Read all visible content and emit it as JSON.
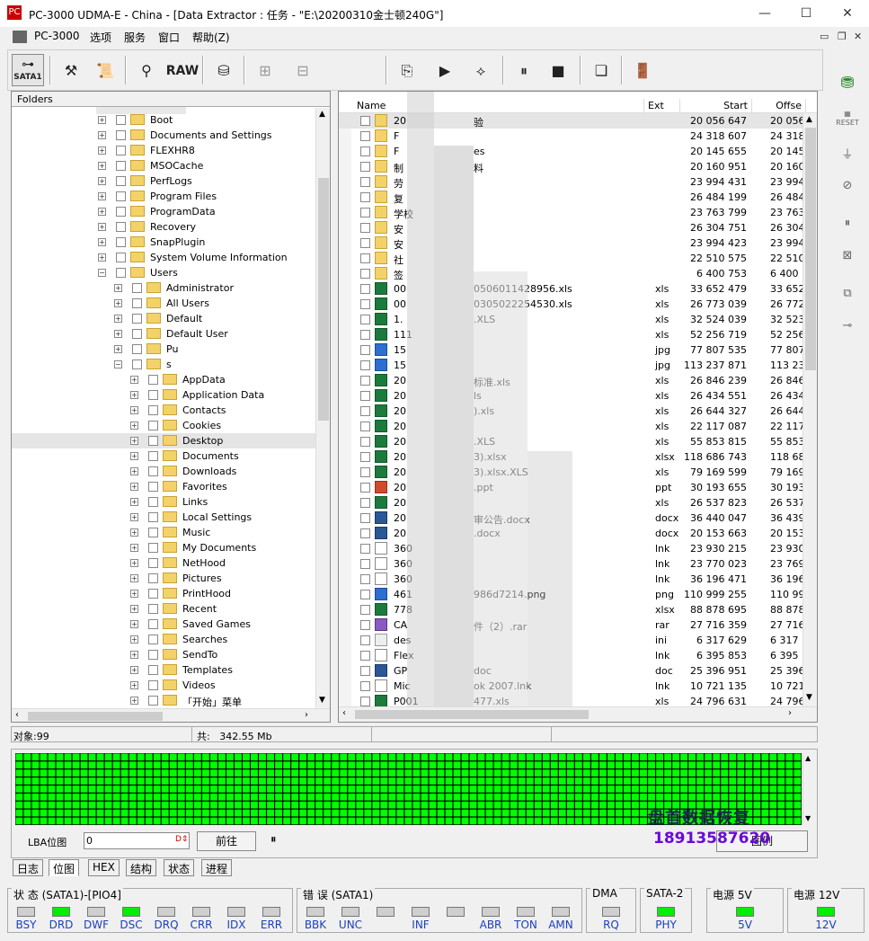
{
  "window": {
    "title": "PC-3000 UDMA-E - China - [Data Extractor : 任务 - \"E:\\20200310金士顿240G\"]",
    "minimize_glyph": "—",
    "maximize_glyph": "☐",
    "close_glyph": "✕"
  },
  "menu": {
    "items": [
      "PC-3000",
      "选项",
      "服务",
      "窗口",
      "帮助(Z)"
    ]
  },
  "toolbar": {
    "sata_label": "SATA1",
    "raw_label": "RAW"
  },
  "rightbar": {
    "reset_label": "RESET"
  },
  "folders": {
    "header": "Folders",
    "items": [
      {
        "label": "Boot",
        "level": 0,
        "expander": "+"
      },
      {
        "label": "Documents and Settings",
        "level": 0,
        "expander": "+"
      },
      {
        "label": "FLEXHR8",
        "level": 0,
        "expander": "+"
      },
      {
        "label": "MSOCache",
        "level": 0,
        "expander": "+"
      },
      {
        "label": "PerfLogs",
        "level": 0,
        "expander": "+"
      },
      {
        "label": "Program Files",
        "level": 0,
        "expander": "+"
      },
      {
        "label": "ProgramData",
        "level": 0,
        "expander": "+"
      },
      {
        "label": "Recovery",
        "level": 0,
        "expander": "+"
      },
      {
        "label": "SnapPlugin",
        "level": 0,
        "expander": "+"
      },
      {
        "label": "System Volume Information",
        "level": 0,
        "expander": "+"
      },
      {
        "label": "Users",
        "level": 0,
        "expander": "−"
      },
      {
        "label": "Administrator",
        "level": 1,
        "expander": "+"
      },
      {
        "label": "All Users",
        "level": 1,
        "expander": "+"
      },
      {
        "label": "Default",
        "level": 1,
        "expander": "+"
      },
      {
        "label": "Default User",
        "level": 1,
        "expander": "+"
      },
      {
        "label": "Pu",
        "level": 1,
        "expander": "+"
      },
      {
        "label": "s",
        "level": 1,
        "expander": "−"
      },
      {
        "label": "AppData",
        "level": 2,
        "expander": "+"
      },
      {
        "label": "Application Data",
        "level": 2,
        "expander": "+"
      },
      {
        "label": "Contacts",
        "level": 2,
        "expander": "+"
      },
      {
        "label": "Cookies",
        "level": 2,
        "expander": "+"
      },
      {
        "label": "Desktop",
        "level": 2,
        "expander": "+"
      },
      {
        "label": "Documents",
        "level": 2,
        "expander": "+"
      },
      {
        "label": "Downloads",
        "level": 2,
        "expander": "+"
      },
      {
        "label": "Favorites",
        "level": 2,
        "expander": "+"
      },
      {
        "label": "Links",
        "level": 2,
        "expander": "+"
      },
      {
        "label": "Local Settings",
        "level": 2,
        "expander": "+"
      },
      {
        "label": "Music",
        "level": 2,
        "expander": "+"
      },
      {
        "label": "My Documents",
        "level": 2,
        "expander": "+"
      },
      {
        "label": "NetHood",
        "level": 2,
        "expander": "+"
      },
      {
        "label": "Pictures",
        "level": 2,
        "expander": "+"
      },
      {
        "label": "PrintHood",
        "level": 2,
        "expander": "+"
      },
      {
        "label": "Recent",
        "level": 2,
        "expander": "+"
      },
      {
        "label": "Saved Games",
        "level": 2,
        "expander": "+"
      },
      {
        "label": "Searches",
        "level": 2,
        "expander": "+"
      },
      {
        "label": "SendTo",
        "level": 2,
        "expander": "+"
      },
      {
        "label": "Templates",
        "level": 2,
        "expander": "+"
      },
      {
        "label": "Videos",
        "level": 2,
        "expander": "+"
      },
      {
        "label": "「开始」菜单",
        "level": 2,
        "expander": "+"
      }
    ]
  },
  "files": {
    "columns": {
      "name": "Name",
      "ext": "Ext",
      "start": "Start",
      "offset": "Offse"
    },
    "rows": [
      {
        "name": "20",
        "suffix": "验",
        "ext": "",
        "start": "20 056 647",
        "offset": "20 056",
        "icon": "folder"
      },
      {
        "name": "F",
        "suffix": "",
        "ext": "",
        "start": "24 318 607",
        "offset": "24 318",
        "icon": "folder"
      },
      {
        "name": "F",
        "suffix": "es",
        "ext": "",
        "start": "20 145 655",
        "offset": "20 145",
        "icon": "folder"
      },
      {
        "name": "制",
        "suffix": "料",
        "ext": "",
        "start": "20 160 951",
        "offset": "20 160",
        "icon": "folder"
      },
      {
        "name": "劳",
        "suffix": "",
        "ext": "",
        "start": "23 994 431",
        "offset": "23 994",
        "icon": "folder"
      },
      {
        "name": "复",
        "suffix": "",
        "ext": "",
        "start": "26 484 199",
        "offset": "26 484",
        "icon": "folder"
      },
      {
        "name": "学校",
        "suffix": "",
        "ext": "",
        "start": "23 763 799",
        "offset": "23 763",
        "icon": "folder"
      },
      {
        "name": "安",
        "suffix": "",
        "ext": "",
        "start": "26 304 751",
        "offset": "26 304",
        "icon": "folder"
      },
      {
        "name": "安",
        "suffix": "",
        "ext": "",
        "start": "23 994 423",
        "offset": "23 994",
        "icon": "folder"
      },
      {
        "name": "社",
        "suffix": "",
        "ext": "",
        "start": "22 510 575",
        "offset": "22 510",
        "icon": "folder"
      },
      {
        "name": "签",
        "suffix": "",
        "ext": "",
        "start": "6 400 753",
        "offset": "6 400",
        "icon": "folder"
      },
      {
        "name": "00",
        "suffix": "0506011428956.xls",
        "ext": "xls",
        "start": "33 652 479",
        "offset": "33 652",
        "icon": "xls"
      },
      {
        "name": "00",
        "suffix": "0305022254530.xls",
        "ext": "xls",
        "start": "26 773 039",
        "offset": "26 772",
        "icon": "xls"
      },
      {
        "name": "1.",
        "suffix": ".XLS",
        "ext": "xls",
        "start": "32 524 039",
        "offset": "32 523",
        "icon": "xls"
      },
      {
        "name": "111",
        "suffix": "",
        "ext": "xls",
        "start": "52 256 719",
        "offset": "52 256",
        "icon": "xls"
      },
      {
        "name": "15",
        "suffix": "",
        "ext": "jpg",
        "start": "77 807 535",
        "offset": "77 807",
        "icon": "img"
      },
      {
        "name": "15",
        "suffix": "",
        "ext": "jpg",
        "start": "113 237 871",
        "offset": "113 237",
        "icon": "img"
      },
      {
        "name": "20",
        "suffix": "标准.xls",
        "ext": "xls",
        "start": "26 846 239",
        "offset": "26 846",
        "icon": "xls"
      },
      {
        "name": "20",
        "suffix": "ls",
        "ext": "xls",
        "start": "26 434 551",
        "offset": "26 434",
        "icon": "xls"
      },
      {
        "name": "20",
        "suffix": ").xls",
        "ext": "xls",
        "start": "26 644 327",
        "offset": "26 644",
        "icon": "xls"
      },
      {
        "name": "20",
        "suffix": "",
        "ext": "xls",
        "start": "22 117 087",
        "offset": "22 117",
        "icon": "xls"
      },
      {
        "name": "20",
        "suffix": ".XLS",
        "ext": "xls",
        "start": "55 853 815",
        "offset": "55 853",
        "icon": "xls"
      },
      {
        "name": "20",
        "suffix": "3).xlsx",
        "ext": "xlsx",
        "start": "118 686 743",
        "offset": "118 686",
        "icon": "xls"
      },
      {
        "name": "20",
        "suffix": "3).xlsx.XLS",
        "ext": "xls",
        "start": "79 169 599",
        "offset": "79 169",
        "icon": "xls"
      },
      {
        "name": "20",
        "suffix": ".ppt",
        "ext": "ppt",
        "start": "30 193 655",
        "offset": "30 193",
        "icon": "ppt"
      },
      {
        "name": "20",
        "suffix": "",
        "ext": "xls",
        "start": "26 537 823",
        "offset": "26 537",
        "icon": "xls"
      },
      {
        "name": "20",
        "suffix": "审公告.docx",
        "ext": "docx",
        "start": "36 440 047",
        "offset": "36 439",
        "icon": "doc"
      },
      {
        "name": "20",
        "suffix": ".docx",
        "ext": "docx",
        "start": "20 153 663",
        "offset": "20 153",
        "icon": "doc"
      },
      {
        "name": "360",
        "suffix": "",
        "ext": "lnk",
        "start": "23 930 215",
        "offset": "23 930",
        "icon": "lnk"
      },
      {
        "name": "360",
        "suffix": "",
        "ext": "lnk",
        "start": "23 770 023",
        "offset": "23 769",
        "icon": "lnk"
      },
      {
        "name": "360",
        "suffix": "",
        "ext": "lnk",
        "start": "36 196 471",
        "offset": "36 196",
        "icon": "lnk"
      },
      {
        "name": "461",
        "suffix": "986d7214.png",
        "ext": "png",
        "start": "110 999 255",
        "offset": "110 999",
        "icon": "img"
      },
      {
        "name": "778",
        "suffix": "",
        "ext": "xlsx",
        "start": "88 878 695",
        "offset": "88 878",
        "icon": "xls"
      },
      {
        "name": "CA",
        "suffix": "件（2）.rar",
        "ext": "rar",
        "start": "27 716 359",
        "offset": "27 716",
        "icon": "rar"
      },
      {
        "name": "des",
        "suffix": "",
        "ext": "ini",
        "start": "6 317 629",
        "offset": "6 317",
        "icon": "ini"
      },
      {
        "name": "Flex",
        "suffix": "",
        "ext": "lnk",
        "start": "6 395 853",
        "offset": "6 395",
        "icon": "lnk"
      },
      {
        "name": "GP",
        "suffix": "doc",
        "ext": "doc",
        "start": "25 396 951",
        "offset": "25 396",
        "icon": "doc"
      },
      {
        "name": "Mic",
        "suffix": "ok 2007.lnk",
        "ext": "lnk",
        "start": "10 721 135",
        "offset": "10 721",
        "icon": "lnk"
      },
      {
        "name": "P001",
        "suffix": "477.xls",
        "ext": "xls",
        "start": "24 796 631",
        "offset": "24 796",
        "icon": "xls"
      }
    ]
  },
  "status_strip": {
    "objects": "对象:99",
    "total": "共:   342.55 Mb"
  },
  "lba": {
    "label": "LBA位图",
    "value": "0",
    "go_button": "前往",
    "pause_glyph": "⏸",
    "legend_button": "图例",
    "grid_color": "#00ff00"
  },
  "bottom_tabs": [
    "日志",
    "位图",
    "HEX",
    "结构",
    "状态",
    "进程"
  ],
  "status_groups": {
    "state": {
      "title": "状 态 (SATA1)-[PIO4]",
      "leds": [
        {
          "label": "BSY",
          "on": false
        },
        {
          "label": "DRD",
          "on": true
        },
        {
          "label": "DWF",
          "on": false
        },
        {
          "label": "DSC",
          "on": true
        },
        {
          "label": "DRQ",
          "on": false
        },
        {
          "label": "CRR",
          "on": false
        },
        {
          "label": "IDX",
          "on": false
        },
        {
          "label": "ERR",
          "on": false
        }
      ]
    },
    "error": {
      "title": "错 误 (SATA1)",
      "leds": [
        {
          "label": "BBK",
          "on": false
        },
        {
          "label": "UNC",
          "on": false
        },
        {
          "label": "",
          "on": false
        },
        {
          "label": "INF",
          "on": false
        },
        {
          "label": "",
          "on": false
        },
        {
          "label": "ABR",
          "on": false
        },
        {
          "label": "TON",
          "on": false
        },
        {
          "label": "AMN",
          "on": false
        }
      ]
    },
    "dma": {
      "title": "DMA",
      "leds": [
        {
          "label": "RQ",
          "on": false
        }
      ]
    },
    "sata2": {
      "title": "SATA-2",
      "leds": [
        {
          "label": "PHY",
          "on": true
        }
      ]
    },
    "power5": {
      "title": "电源 5V",
      "leds": [
        {
          "label": "5V",
          "on": true
        }
      ]
    },
    "power12": {
      "title": "电源 12V",
      "leds": [
        {
          "label": "12V",
          "on": true
        }
      ]
    }
  },
  "watermark": {
    "line1": "盘首数据恢复",
    "line2": "18913587620"
  }
}
